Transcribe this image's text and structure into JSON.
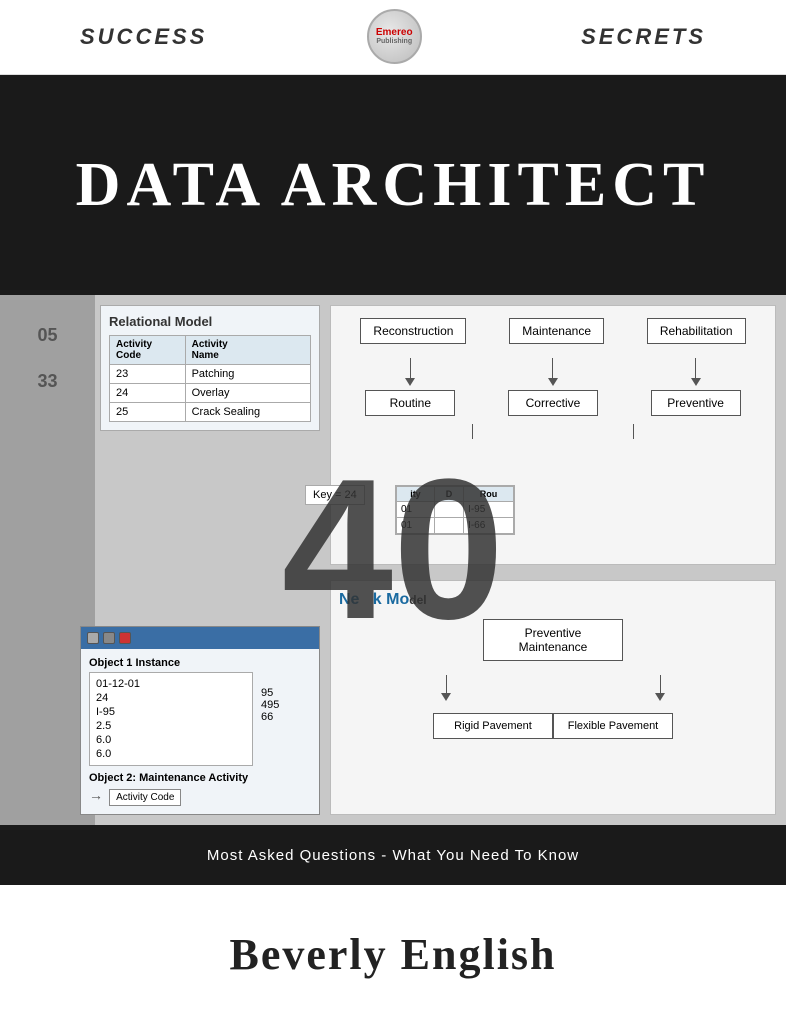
{
  "top": {
    "success": "SUCCESS",
    "secrets": "SECRETS",
    "logo": {
      "name": "Emereo",
      "sub": "Publishing"
    }
  },
  "title": {
    "main": "DATA ARCHITECT"
  },
  "collage": {
    "left_numbers": [
      "05",
      "33"
    ],
    "relational_model": {
      "title": "Relational Model",
      "columns": [
        "Activity Code",
        "Activity Name"
      ],
      "rows": [
        {
          "code": "23",
          "name": "Patching"
        },
        {
          "code": "24",
          "name": "Overlay"
        },
        {
          "code": "25",
          "name": "Crack Sealing"
        }
      ]
    },
    "diagram": {
      "top_row": [
        "Reconstruction",
        "Maintenance",
        "Rehabilitation"
      ],
      "bottom_row": [
        "Routine",
        "Corrective",
        "Preventive"
      ]
    },
    "big_number": "40",
    "key_label": "Key = 24",
    "mid_table": {
      "headers": [
        "ity",
        "D",
        "Rou"
      ],
      "rows": [
        [
          "01",
          "I-95"
        ],
        [
          "01",
          "I-66"
        ]
      ]
    },
    "network_mo_label": "Ne   k Mo",
    "pm_diagram": {
      "top": "Preventive Maintenance",
      "branches": [
        "Rigid Pavement",
        "Flexible Pavement"
      ]
    },
    "window": {
      "title": "Object 1 Instance",
      "values": [
        "01-12-01",
        "24",
        "I-95",
        "2.5",
        "6.0",
        "6.0"
      ],
      "obj2": "Object 2: Maintenance Activity",
      "activity": "Activity Code",
      "right_values": [
        "95",
        "495",
        "66"
      ]
    }
  },
  "subtitle": "Most Asked Questions - What You Need To Know",
  "author": "Beverly English"
}
